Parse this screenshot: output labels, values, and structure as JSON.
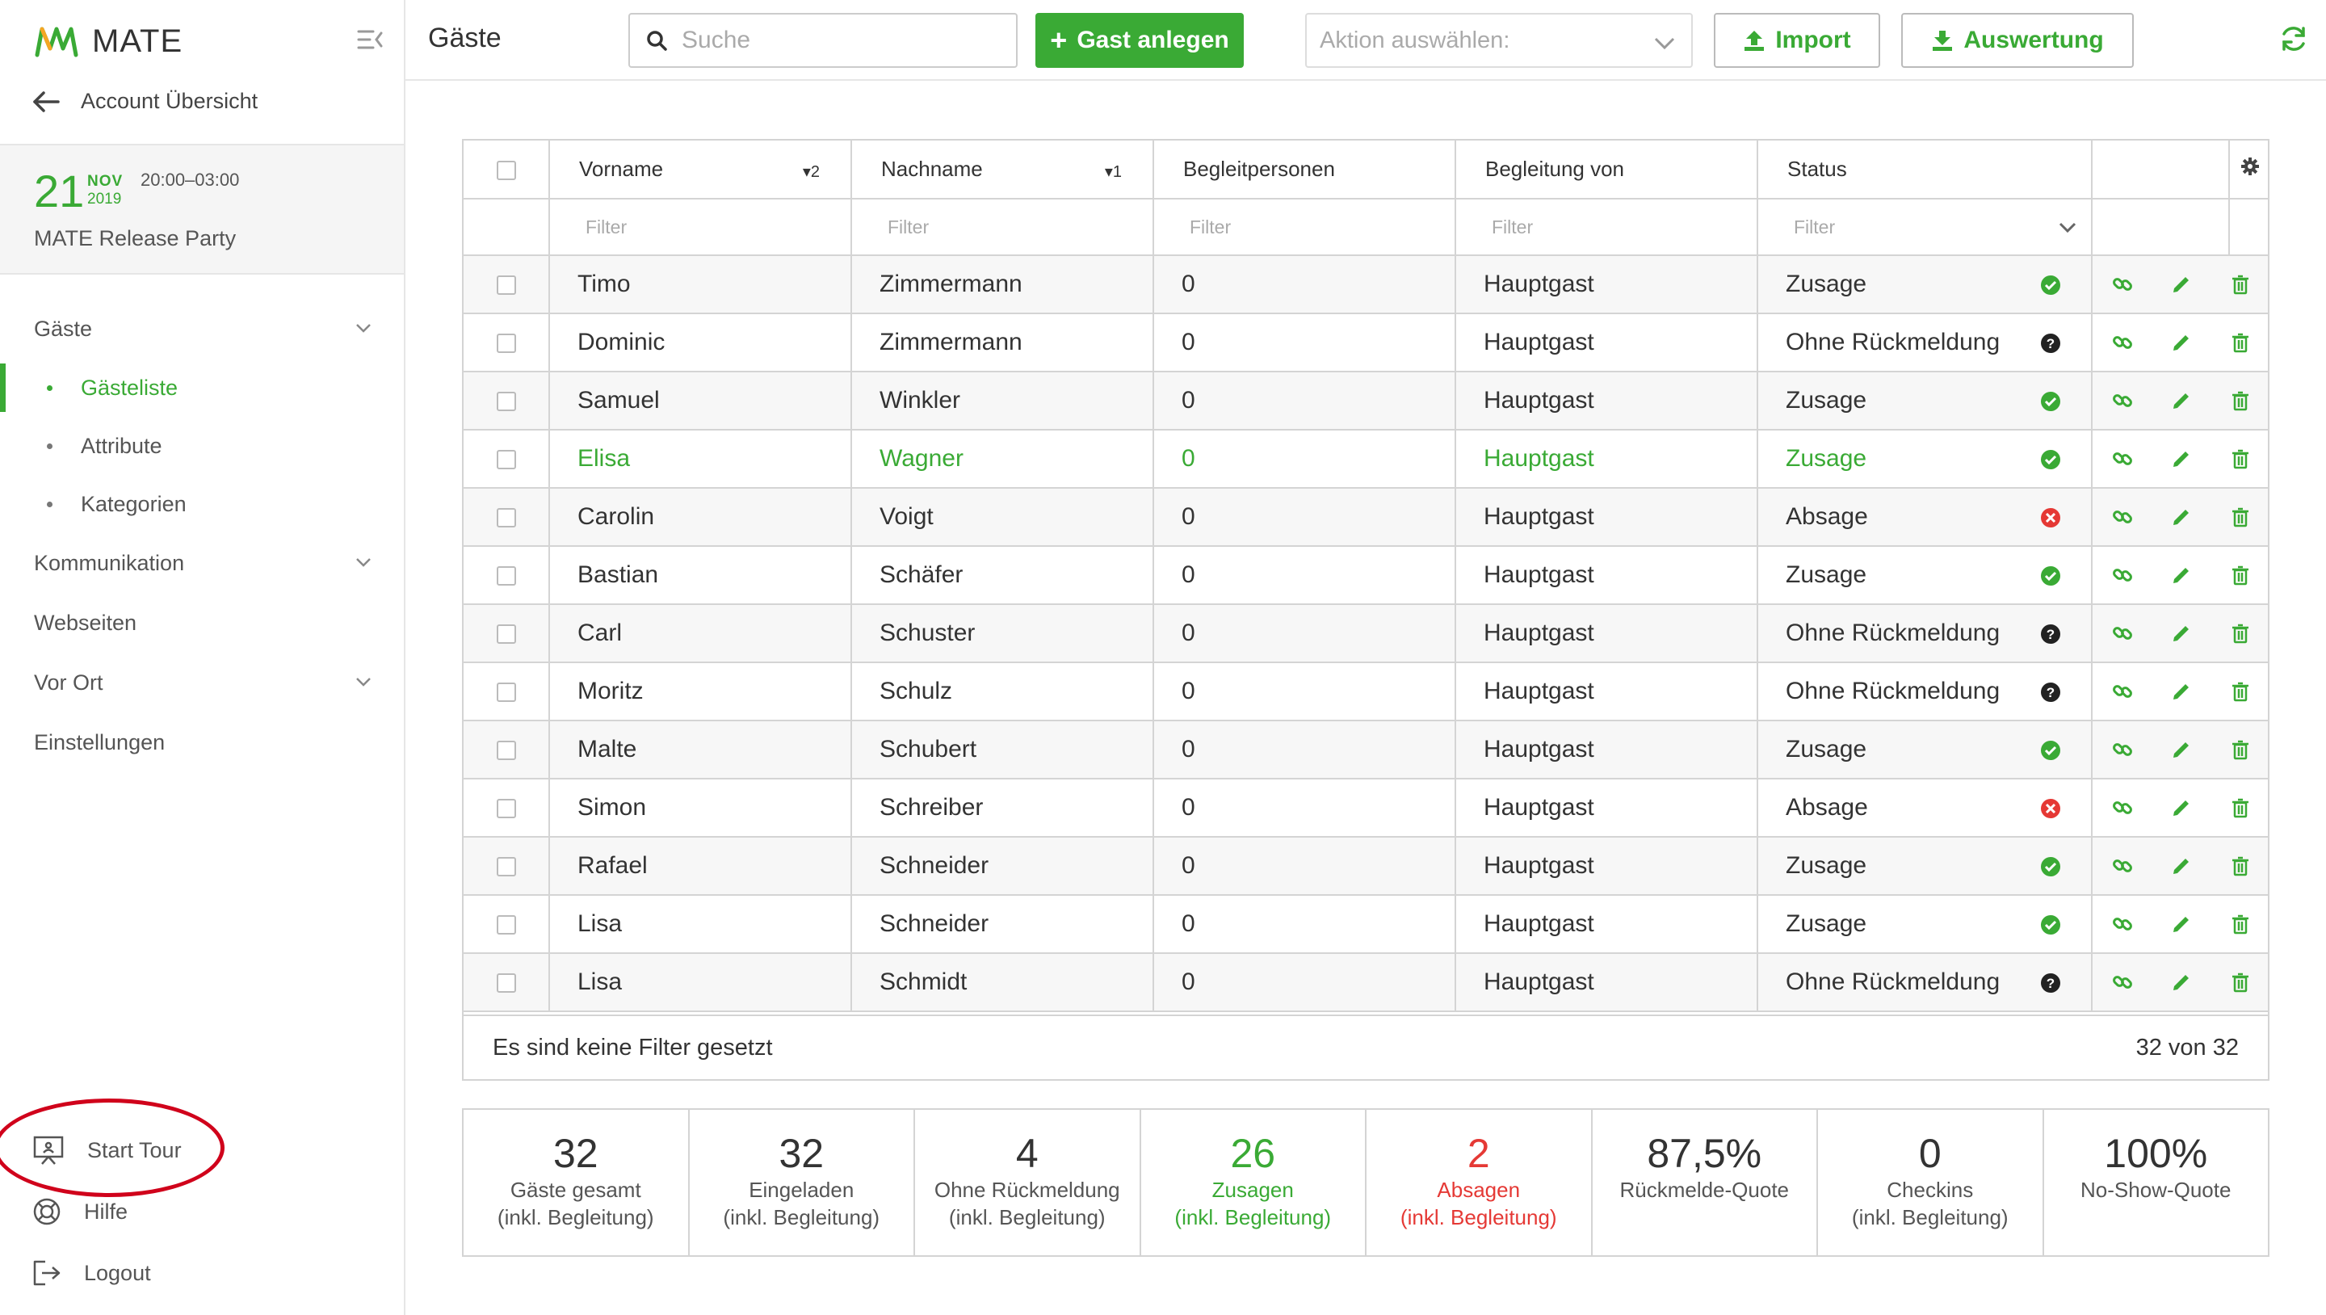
{
  "app": {
    "name": "MATE"
  },
  "sidebar": {
    "back_label": "Account Übersicht",
    "event": {
      "day": "21",
      "month": "NOV",
      "year": "2019",
      "time": "20:00–03:00",
      "name": "MATE Release Party"
    },
    "nav": {
      "gaeste": "Gäste",
      "gaesteliste": "Gästeliste",
      "attribute": "Attribute",
      "kategorien": "Kategorien",
      "kommunikation": "Kommunikation",
      "webseiten": "Webseiten",
      "vor_ort": "Vor Ort",
      "einstellungen": "Einstellungen"
    },
    "bottom": {
      "start_tour": "Start Tour",
      "hilfe": "Hilfe",
      "logout": "Logout"
    }
  },
  "header": {
    "title": "Gäste",
    "search_placeholder": "Suche",
    "add_guest": "Gast anlegen",
    "action_placeholder": "Aktion auswählen:",
    "import": "Import",
    "auswertung": "Auswertung"
  },
  "table": {
    "columns": {
      "vorname": "Vorname",
      "vorname_sort": "2",
      "nachname": "Nachname",
      "nachname_sort": "1",
      "begleitpersonen": "Begleitpersonen",
      "begleitung_von": "Begleitung von",
      "status": "Status"
    },
    "filter_placeholder": "Filter",
    "rows": [
      {
        "vorname": "Timo",
        "nachname": "Zimmermann",
        "begleitpersonen": "0",
        "begleitung_von": "Hauptgast",
        "status": "Zusage",
        "status_type": "yes"
      },
      {
        "vorname": "Dominic",
        "nachname": "Zimmermann",
        "begleitpersonen": "0",
        "begleitung_von": "Hauptgast",
        "status": "Ohne Rückmeldung",
        "status_type": "unknown"
      },
      {
        "vorname": "Samuel",
        "nachname": "Winkler",
        "begleitpersonen": "0",
        "begleitung_von": "Hauptgast",
        "status": "Zusage",
        "status_type": "yes"
      },
      {
        "vorname": "Elisa",
        "nachname": "Wagner",
        "begleitpersonen": "0",
        "begleitung_von": "Hauptgast",
        "status": "Zusage",
        "status_type": "yes"
      },
      {
        "vorname": "Carolin",
        "nachname": "Voigt",
        "begleitpersonen": "0",
        "begleitung_von": "Hauptgast",
        "status": "Absage",
        "status_type": "no"
      },
      {
        "vorname": "Bastian",
        "nachname": "Schäfer",
        "begleitpersonen": "0",
        "begleitung_von": "Hauptgast",
        "status": "Zusage",
        "status_type": "yes"
      },
      {
        "vorname": "Carl",
        "nachname": "Schuster",
        "begleitpersonen": "0",
        "begleitung_von": "Hauptgast",
        "status": "Ohne Rückmeldung",
        "status_type": "unknown"
      },
      {
        "vorname": "Moritz",
        "nachname": "Schulz",
        "begleitpersonen": "0",
        "begleitung_von": "Hauptgast",
        "status": "Ohne Rückmeldung",
        "status_type": "unknown"
      },
      {
        "vorname": "Malte",
        "nachname": "Schubert",
        "begleitpersonen": "0",
        "begleitung_von": "Hauptgast",
        "status": "Zusage",
        "status_type": "yes"
      },
      {
        "vorname": "Simon",
        "nachname": "Schreiber",
        "begleitpersonen": "0",
        "begleitung_von": "Hauptgast",
        "status": "Absage",
        "status_type": "no"
      },
      {
        "vorname": "Rafael",
        "nachname": "Schneider",
        "begleitpersonen": "0",
        "begleitung_von": "Hauptgast",
        "status": "Zusage",
        "status_type": "yes"
      },
      {
        "vorname": "Lisa",
        "nachname": "Schneider",
        "begleitpersonen": "0",
        "begleitung_von": "Hauptgast",
        "status": "Zusage",
        "status_type": "yes"
      },
      {
        "vorname": "Lisa",
        "nachname": "Schmidt",
        "begleitpersonen": "0",
        "begleitung_von": "Hauptgast",
        "status": "Ohne Rückmeldung",
        "status_type": "unknown"
      }
    ],
    "footer_left": "Es sind keine Filter gesetzt",
    "footer_right": "32 von 32"
  },
  "stats": [
    {
      "value": "32",
      "label1": "Gäste gesamt",
      "label2": "(inkl. Begleitung)",
      "tone": "default"
    },
    {
      "value": "32",
      "label1": "Eingeladen",
      "label2": "(inkl. Begleitung)",
      "tone": "default"
    },
    {
      "value": "4",
      "label1": "Ohne Rückmeldung",
      "label2": "(inkl. Begleitung)",
      "tone": "default"
    },
    {
      "value": "26",
      "label1": "Zusagen",
      "label2": "(inkl. Begleitung)",
      "tone": "green"
    },
    {
      "value": "2",
      "label1": "Absagen",
      "label2": "(inkl. Begleitung)",
      "tone": "red"
    },
    {
      "value": "87,5%",
      "label1": "Rückmelde-Quote",
      "label2": "",
      "tone": "default"
    },
    {
      "value": "0",
      "label1": "Checkins",
      "label2": "(inkl. Begleitung)",
      "tone": "default"
    },
    {
      "value": "100%",
      "label1": "No-Show-Quote",
      "label2": "",
      "tone": "default"
    }
  ],
  "colors": {
    "accent": "#3aaa35",
    "danger": "#e53935",
    "highlight_ring": "#d0021b"
  },
  "icons": {
    "status_yes": "check-circle-icon",
    "status_no": "x-circle-icon",
    "status_unknown": "question-circle-icon",
    "row_actions": [
      "link-icon",
      "pencil-icon",
      "trash-icon"
    ]
  }
}
